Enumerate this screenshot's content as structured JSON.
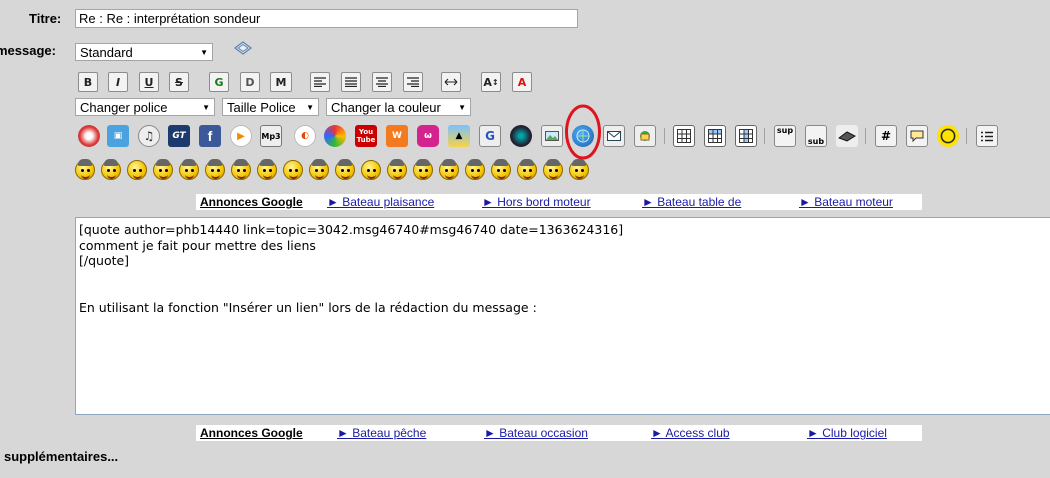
{
  "form": {
    "title_label": "Titre:",
    "title_value": "Re : Re : interprétation sondeur",
    "message_label": "message:",
    "message_type": "Standard"
  },
  "format_toolbar": {
    "bold": "B",
    "italic": "I",
    "underline": "U",
    "strike": "S",
    "glow": "G",
    "shadow": "D",
    "marquee": "M",
    "font_size_tool": "A",
    "color_tool": "A"
  },
  "dropdowns": {
    "font": "Changer police",
    "size": "Taille Police",
    "color": "Changer la couleur"
  },
  "media_toolbar": {
    "gametrailers": "GT",
    "facebook": "f",
    "mp3": "Mp3",
    "youtube": "You Tube",
    "google_video": "G",
    "sup": "sup",
    "sub": "sub",
    "hash": "#"
  },
  "ads_top": {
    "header": "Annonces Google",
    "links": [
      "► Bateau plaisance",
      "► Hors bord moteur",
      "► Bateau table de",
      "► Bateau moteur"
    ]
  },
  "message_body": "[quote author=phb14440 link=topic=3042.msg46740#msg46740 date=1363624316]\ncomment je fait pour mettre des liens\n[/quote]\n\n\nEn utilisant la fonction \"Insérer un lien\" lors de la rédaction du message :",
  "ads_bottom": {
    "header": "Annonces Google",
    "links": [
      "► Bateau pêche",
      "► Bateau occasion",
      "► Access club",
      "► Club logiciel"
    ]
  },
  "options_label": "supplémentaires...",
  "colors": {
    "highlight_circle": "#e0141e",
    "ad_link": "#1a1aa6",
    "background": "#d7d7d7"
  }
}
